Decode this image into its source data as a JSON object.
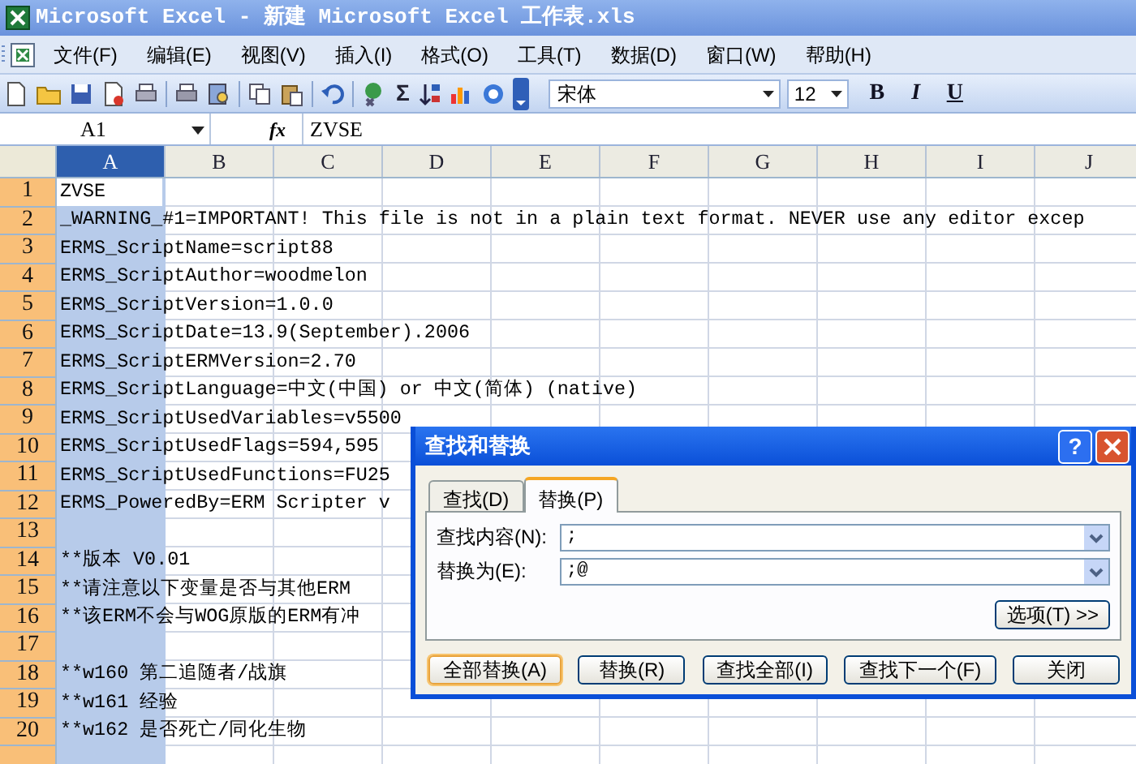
{
  "window": {
    "title": "Microsoft Excel - 新建 Microsoft Excel 工作表.xls"
  },
  "menu": [
    "文件(F)",
    "编辑(E)",
    "视图(V)",
    "插入(I)",
    "格式(O)",
    "工具(T)",
    "数据(D)",
    "窗口(W)",
    "帮助(H)"
  ],
  "toolbar": {
    "autosum": "Σ",
    "font": "宋体",
    "font_size": "12",
    "format_buttons": [
      {
        "label": "B",
        "kind": "bold"
      },
      {
        "label": "I",
        "kind": "italic"
      },
      {
        "label": "U",
        "kind": "underline"
      }
    ]
  },
  "formula_bar": {
    "name_box": "A1",
    "fx": "fx",
    "content": "ZVSE"
  },
  "columns": [
    {
      "label": "A",
      "selected": true
    },
    {
      "label": "B",
      "selected": false
    },
    {
      "label": "C",
      "selected": false
    },
    {
      "label": "D",
      "selected": false
    },
    {
      "label": "E",
      "selected": false
    },
    {
      "label": "F",
      "selected": false
    },
    {
      "label": "G",
      "selected": false
    },
    {
      "label": "H",
      "selected": false
    },
    {
      "label": "I",
      "selected": false
    },
    {
      "label": "J",
      "selected": false
    }
  ],
  "rows": [
    {
      "number": "1",
      "text": "ZVSE",
      "selected": true,
      "active": true
    },
    {
      "number": "2",
      "text": "_WARNING_#1=IMPORTANT! This file is not in a plain text format. NEVER use any editor excep",
      "selected": true,
      "active": false
    },
    {
      "number": "3",
      "text": "ERMS_ScriptName=script88",
      "selected": true,
      "active": false
    },
    {
      "number": "4",
      "text": "ERMS_ScriptAuthor=woodmelon",
      "selected": true,
      "active": false
    },
    {
      "number": "5",
      "text": "ERMS_ScriptVersion=1.0.0",
      "selected": true,
      "active": false
    },
    {
      "number": "6",
      "text": "ERMS_ScriptDate=13.9(September).2006",
      "selected": true,
      "active": false
    },
    {
      "number": "7",
      "text": "ERMS_ScriptERMVersion=2.70",
      "selected": true,
      "active": false
    },
    {
      "number": "8",
      "text": "ERMS_ScriptLanguage=中文(中国) or 中文(简体) (native)",
      "selected": true,
      "active": false
    },
    {
      "number": "9",
      "text": "ERMS_ScriptUsedVariables=v5500",
      "selected": true,
      "active": false
    },
    {
      "number": "10",
      "text": "ERMS_ScriptUsedFlags=594,595",
      "selected": true,
      "active": false
    },
    {
      "number": "11",
      "text": "ERMS_ScriptUsedFunctions=FU25",
      "selected": true,
      "active": false
    },
    {
      "number": "12",
      "text": "ERMS_PoweredBy=ERM Scripter v",
      "selected": true,
      "active": false
    },
    {
      "number": "13",
      "selected": true,
      "active": false
    },
    {
      "number": "14",
      "text": "**版本 V0.01",
      "selected": true,
      "active": false
    },
    {
      "number": "15",
      "text": "**请注意以下变量是否与其他ERM",
      "selected": true,
      "active": false
    },
    {
      "number": "16",
      "text": "**该ERM不会与WOG原版的ERM有冲",
      "selected": true,
      "active": false
    },
    {
      "number": "17",
      "selected": true,
      "active": false
    },
    {
      "number": "18",
      "text": "**w160 第二追随者/战旗",
      "selected": true,
      "active": false
    },
    {
      "number": "19",
      "text": "**w161 经验",
      "selected": true,
      "active": false
    },
    {
      "number": "20",
      "text": "**w162 是否死亡/同化生物",
      "selected": true,
      "active": false
    }
  ],
  "dialog": {
    "title": "查找和替换",
    "help": "?",
    "tabs": [
      {
        "label": "查找(D)",
        "selected": false
      },
      {
        "label": "替换(P)",
        "selected": true
      }
    ],
    "fields": [
      {
        "label": "查找内容(N):",
        "value": ";"
      },
      {
        "label": "替换为(E):",
        "value": ";@"
      }
    ],
    "options_button": "选项(T) >>",
    "buttons": [
      {
        "label": "全部替换(A)",
        "default": true
      },
      {
        "label": "替换(R)",
        "default": false
      },
      {
        "label": "查找全部(I)",
        "default": false
      },
      {
        "label": "查找下一个(F)",
        "default": false
      },
      {
        "label": "关闭",
        "default": false
      }
    ]
  }
}
